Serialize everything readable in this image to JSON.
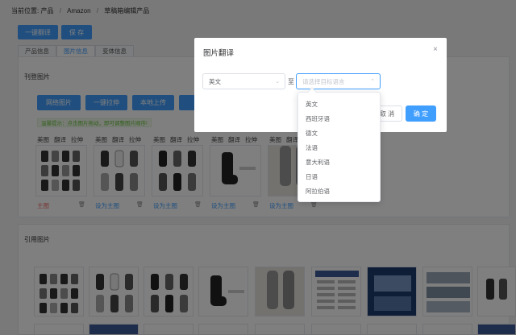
{
  "breadcrumb": {
    "label": "当前位置:",
    "items": [
      "产品",
      "Amazon",
      "草稿箱编辑产品"
    ]
  },
  "toolbar": {
    "one_click_translate": "一键翻译",
    "save": "保 存"
  },
  "tabs": [
    "产品信息",
    "图片信息",
    "变体信息"
  ],
  "upload_section": {
    "title": "刊登图片",
    "buttons": [
      "网络图片",
      "一键拉伸",
      "本地上传"
    ],
    "hint": "温馨提示：点击图片拖动，即可调整图片顺序!"
  },
  "card_actions": [
    "美图",
    "翻译",
    "拉伸"
  ],
  "cards": [
    {
      "foot": "主图",
      "is_main": true
    },
    {
      "foot": "设为主图",
      "is_main": false
    },
    {
      "foot": "设为主图",
      "is_main": false
    },
    {
      "foot": "设为主图",
      "is_main": false
    },
    {
      "foot": "设为主图",
      "is_main": false
    }
  ],
  "reference_section": {
    "title": "引用图片"
  },
  "modal": {
    "title": "图片翻译",
    "close": "×",
    "source_language": "英文",
    "to": "至",
    "target_placeholder": "请选择目标语言",
    "cancel": "取 消",
    "confirm": "确 定"
  },
  "language_options": [
    "英文",
    "西班牙语",
    "德文",
    "法语",
    "意大利语",
    "日语",
    "阿拉伯语"
  ],
  "colors": {
    "primary": "#409eff",
    "danger": "#f56c6c",
    "success": "#67c23a"
  }
}
